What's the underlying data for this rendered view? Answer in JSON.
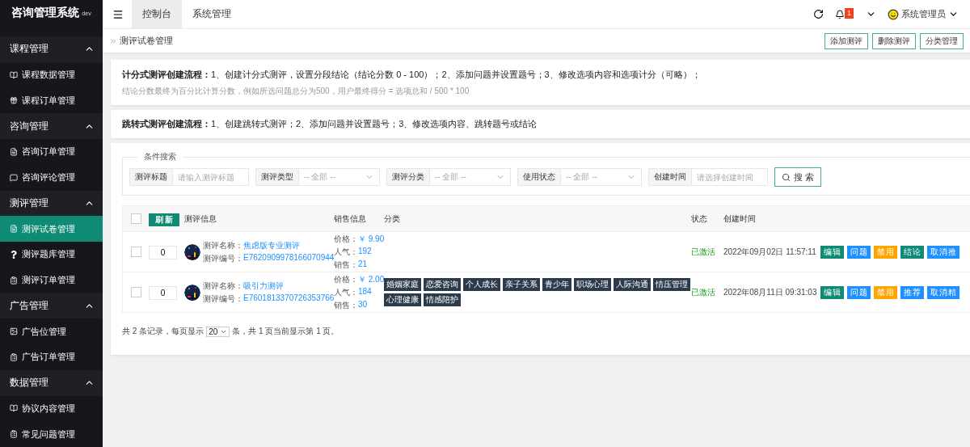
{
  "app": {
    "title": "咨询管理系统",
    "env": "dev"
  },
  "sidebar": {
    "groups": [
      {
        "label": "课程管理",
        "expanded": true,
        "items": [
          {
            "label": "课程数据管理",
            "selected": false
          },
          {
            "label": "课程订单管理",
            "selected": false
          }
        ]
      },
      {
        "label": "咨询管理",
        "expanded": true,
        "items": [
          {
            "label": "咨询订单管理",
            "selected": false
          },
          {
            "label": "咨询评论管理",
            "selected": false
          }
        ]
      },
      {
        "label": "测评管理",
        "expanded": true,
        "items": [
          {
            "label": "测评试卷管理",
            "selected": true
          },
          {
            "label": "测评题库管理",
            "selected": false
          },
          {
            "label": "测评订单管理",
            "selected": false
          }
        ]
      },
      {
        "label": "广告管理",
        "expanded": true,
        "items": [
          {
            "label": "广告位管理",
            "selected": false
          },
          {
            "label": "广告订单管理",
            "selected": false
          }
        ]
      },
      {
        "label": "数据管理",
        "expanded": true,
        "items": [
          {
            "label": "协议内容管理",
            "selected": false
          },
          {
            "label": "常见问题管理",
            "selected": false
          }
        ]
      }
    ]
  },
  "header": {
    "tabs": [
      {
        "label": "控制台",
        "selected": true
      },
      {
        "label": "系统管理",
        "selected": false
      }
    ],
    "notification_count": "1",
    "user": "系统管理员"
  },
  "breadcrumb": "测评试卷管理",
  "toolbar": [
    "添加测评",
    "删除测评",
    "分类管理"
  ],
  "notices": [
    {
      "text": "**计分式测评创建流程：**1、创建计分式测评，设置分段结论（结论分数 0 - 100）；2、添加问题并设置题号；3、修改选项内容和选项计分（可略）；",
      "note": "结论分数最终为百分比计算分数，例如所选问题总分为500，用户最终得分 = 选项总和 / 500 * 100"
    },
    {
      "text": "**跳转式测评创建流程：**1、创建跳转式测评；2、添加问题并设置题号；3、修改选项内容、跳转题号或结论"
    }
  ],
  "search": {
    "legend": "条件搜索",
    "fields": [
      {
        "kind": "input",
        "label": "测评标题",
        "placeholder": "请输入测评标题"
      },
      {
        "kind": "select",
        "label": "测评类型",
        "value": "-- 全部 --"
      },
      {
        "kind": "select",
        "label": "测评分类",
        "value": "-- 全部 --"
      },
      {
        "kind": "select",
        "label": "使用状态",
        "value": "-- 全部 --"
      },
      {
        "kind": "input",
        "label": "创建时间",
        "placeholder": "请选择创建时间"
      }
    ],
    "button": "搜 索"
  },
  "table": {
    "all_checked": false,
    "refresh": "刷 新",
    "columns": [
      "测评信息",
      "销售信息",
      "分类",
      "状态",
      "创建时间"
    ],
    "rows": [
      {
        "checked": false,
        "sort": "0",
        "name_label": "测评名称：",
        "name": "焦虑版专业测评",
        "code_label": "测评编号：",
        "code": "E7620909978166070944",
        "sales": [
          {
            "label": "价格：",
            "value": "￥ 9.90"
          },
          {
            "label": "人气：",
            "value": "192"
          },
          {
            "label": "销售：",
            "value": "21"
          }
        ],
        "tags": [],
        "status": "已激活",
        "created": "2022年09月02日 11:57:11",
        "actions": [
          {
            "label": "编辑",
            "kind": "primary"
          },
          {
            "label": "问题",
            "kind": "info"
          },
          {
            "label": "禁用",
            "kind": "warning"
          },
          {
            "label": "结论",
            "kind": "primary"
          },
          {
            "label": "取消推",
            "kind": "info"
          }
        ]
      },
      {
        "checked": false,
        "sort": "0",
        "name_label": "测评名称：",
        "name": "吸引力测评",
        "code_label": "测评编号：",
        "code": "E7601813370726353766",
        "sales": [
          {
            "label": "价格：",
            "value": "￥ 2.00"
          },
          {
            "label": "人气：",
            "value": "184"
          },
          {
            "label": "销售：",
            "value": "30"
          }
        ],
        "tags": [
          "婚姻家庭",
          "恋爱咨询",
          "个人成长",
          "亲子关系",
          "青少年",
          "职场心理",
          "人际沟通",
          "情压管理",
          "心理健康",
          "情感陪护"
        ],
        "status": "已激活",
        "created": "2022年08月11日 09:31:03",
        "actions": [
          {
            "label": "编辑",
            "kind": "primary"
          },
          {
            "label": "问题",
            "kind": "info"
          },
          {
            "label": "禁用",
            "kind": "warning"
          },
          {
            "label": "推荐",
            "kind": "info"
          },
          {
            "label": "取消精",
            "kind": "info"
          }
        ]
      }
    ]
  },
  "pager": {
    "before": "共 2 条记录，每页显示",
    "page_size": "20",
    "after": "条，共 1 页当前显示第 1 页。"
  }
}
